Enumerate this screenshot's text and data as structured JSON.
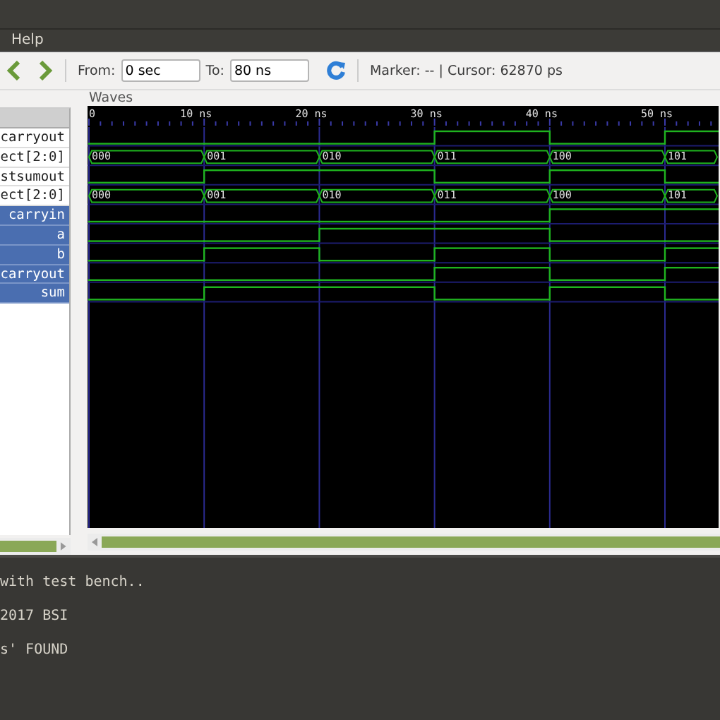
{
  "menu_bar": {
    "items": [
      "Help"
    ]
  },
  "toolbar": {
    "from_label": "From:",
    "from_value": "0 sec",
    "to_label": "To:",
    "to_value": "80 ns",
    "status": "Marker: -- | Cursor: 62870 ps"
  },
  "waves_title": "Waves",
  "time_ticks": [
    "0",
    "10 ns",
    "20 ns",
    "30 ns",
    "40 ns",
    "50 ns"
  ],
  "signals": [
    {
      "name": "carryout",
      "selected": false,
      "kind": "bit",
      "high": [
        false,
        false,
        false,
        true,
        false,
        true
      ]
    },
    {
      "name": "ect[2:0]",
      "selected": false,
      "kind": "bus",
      "values": [
        "000",
        "001",
        "010",
        "011",
        "100",
        "101"
      ]
    },
    {
      "name": "stsumout",
      "selected": false,
      "kind": "bit",
      "high": [
        false,
        true,
        true,
        false,
        true,
        false
      ]
    },
    {
      "name": "ect[2:0]",
      "selected": false,
      "kind": "bus",
      "values": [
        "000",
        "001",
        "010",
        "011",
        "100",
        "101"
      ]
    },
    {
      "name": "carryin",
      "selected": true,
      "kind": "bit",
      "high": [
        false,
        false,
        false,
        false,
        true,
        true
      ]
    },
    {
      "name": "a",
      "selected": true,
      "kind": "bit",
      "high": [
        false,
        false,
        true,
        true,
        false,
        false
      ]
    },
    {
      "name": "b",
      "selected": true,
      "kind": "bit",
      "high": [
        false,
        true,
        false,
        true,
        false,
        true
      ]
    },
    {
      "name": "carryout",
      "selected": true,
      "kind": "bit",
      "high": [
        false,
        false,
        false,
        true,
        false,
        true
      ]
    },
    {
      "name": "sum",
      "selected": true,
      "kind": "bit",
      "high": [
        false,
        true,
        true,
        false,
        true,
        false
      ]
    }
  ],
  "console": {
    "lines": [
      "with test bench..",
      "2017 BSI",
      "s' FOUND"
    ]
  }
}
